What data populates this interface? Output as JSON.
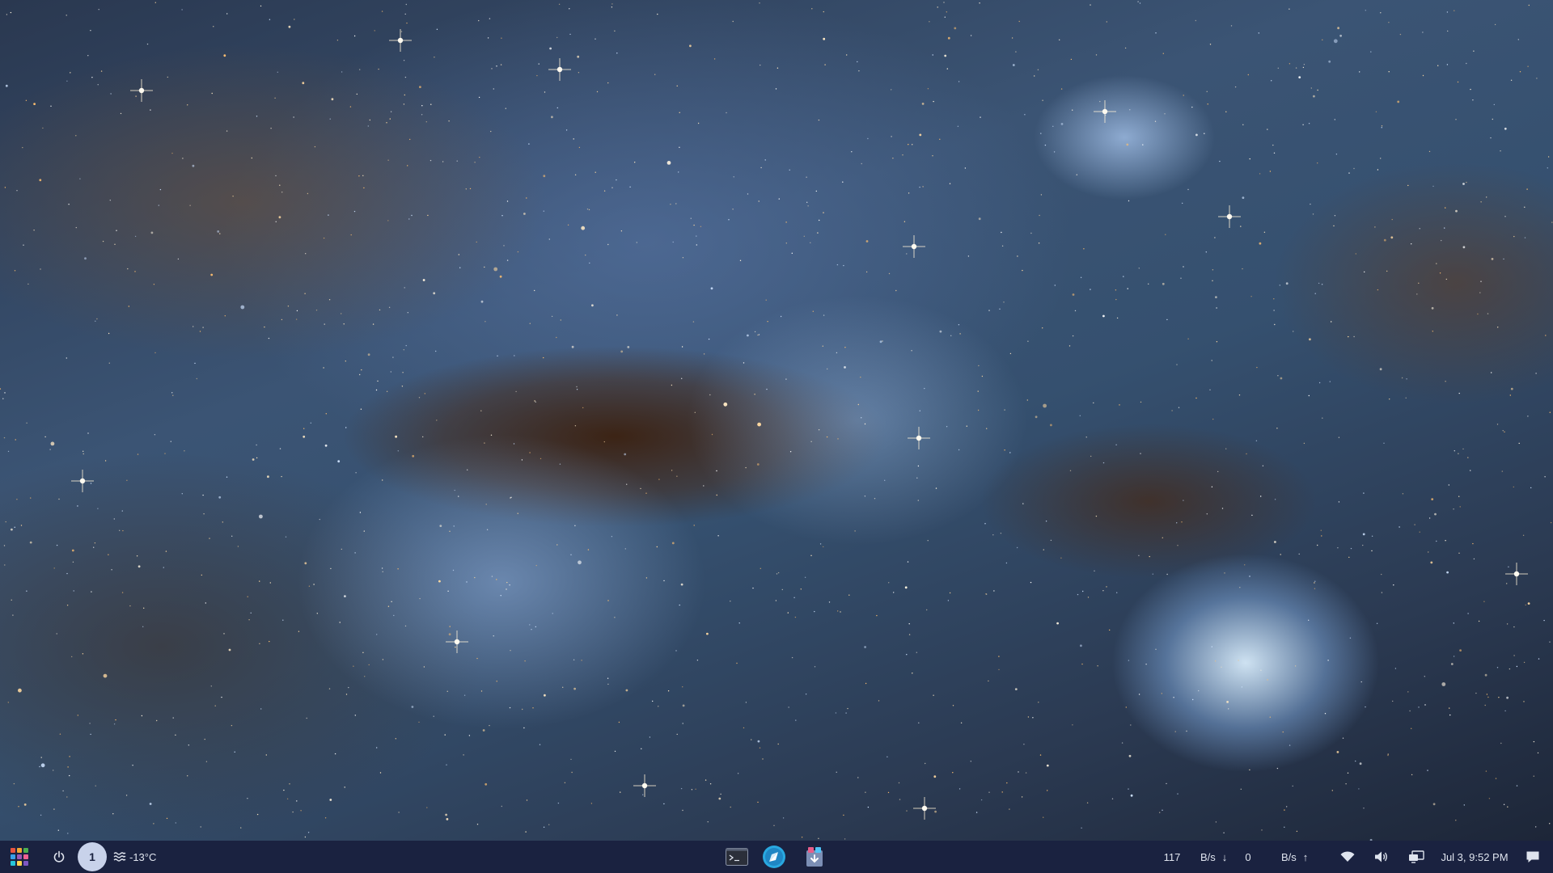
{
  "taskbar": {
    "launcher_icon": "app-grid-icon",
    "power_icon": "power-icon",
    "workspace_number": "1",
    "weather": {
      "icon": "fog-icon",
      "temperature": "-13°C"
    },
    "tasks": [
      {
        "name": "terminal",
        "icon": "terminal-icon"
      },
      {
        "name": "browser",
        "icon": "browser-icon"
      },
      {
        "name": "installer",
        "icon": "package-installer-icon"
      }
    ],
    "network": {
      "download_value": "117",
      "download_unit": "B/s",
      "download_arrow": "↓",
      "upload_value": "0",
      "upload_unit": "B/s",
      "upload_arrow": "↑"
    },
    "tray_icons": [
      "wifi-icon",
      "volume-icon",
      "display-icon",
      "notification-icon"
    ],
    "clock": "Jul 3, 9:52 PM"
  },
  "colors": {
    "taskbar_bg": "#1a2240",
    "taskbar_text": "#dfe4ee",
    "workspace_pill": "#c8d2ea",
    "launcher_tiles": [
      "#e8553f",
      "#f3a833",
      "#4caf50",
      "#3aa0e8",
      "#9b59b6",
      "#f06292",
      "#26c6da",
      "#ffd54f",
      "#7e57c2"
    ]
  },
  "desktop": {
    "wallpaper": "nebula-starfield"
  }
}
